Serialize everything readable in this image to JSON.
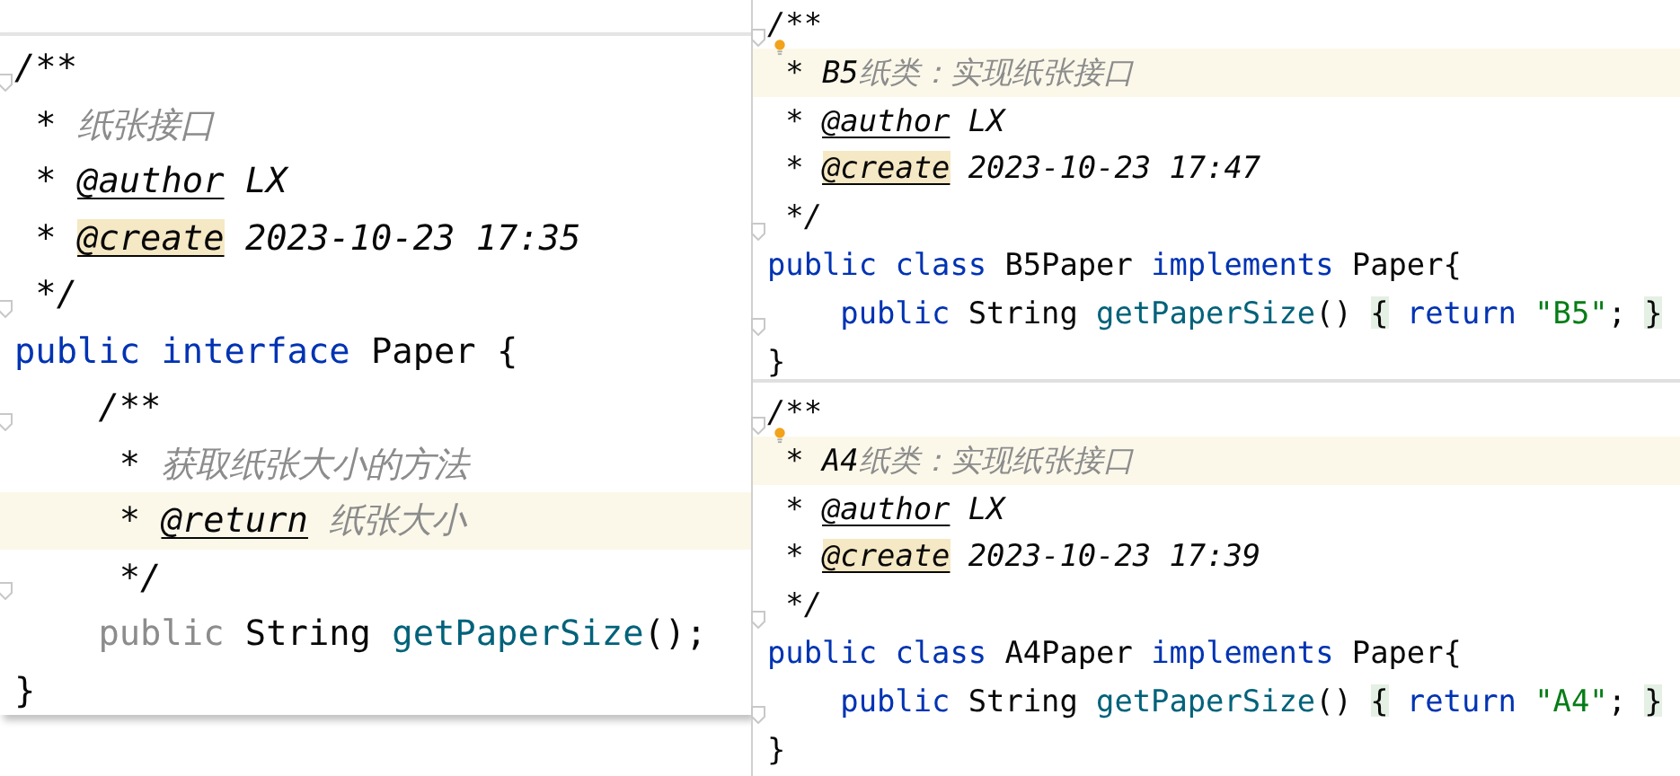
{
  "editors": [
    {
      "lines": [
        {
          "fold": true,
          "highlighted": false,
          "tokens": [
            {
              "text": "/**",
              "kind": "punct"
            }
          ]
        },
        {
          "fold": false,
          "highlighted": false,
          "tokens": [
            {
              "text": " * ",
              "kind": "punct"
            },
            {
              "text": "纸张接口",
              "kind": "doc"
            }
          ]
        },
        {
          "fold": false,
          "highlighted": false,
          "tokens": [
            {
              "text": " * ",
              "kind": "punct"
            },
            {
              "text": "@author",
              "kind": "tag"
            },
            {
              "text": " LX",
              "kind": "value"
            }
          ]
        },
        {
          "fold": false,
          "highlighted": false,
          "tokens": [
            {
              "text": " * ",
              "kind": "punct"
            },
            {
              "text": "@create",
              "kind": "tag-marked"
            },
            {
              "text": " 2023-10-23 17:35",
              "kind": "value"
            }
          ]
        },
        {
          "fold": true,
          "highlighted": false,
          "tokens": [
            {
              "text": " */",
              "kind": "punct"
            }
          ]
        },
        {
          "fold": false,
          "highlighted": false,
          "tokens": [
            {
              "text": "public ",
              "kind": "keyword"
            },
            {
              "text": "interface ",
              "kind": "keyword"
            },
            {
              "text": "Paper {",
              "kind": "plain"
            }
          ]
        },
        {
          "fold": true,
          "highlighted": false,
          "tokens": [
            {
              "text": "    /**",
              "kind": "punct"
            }
          ]
        },
        {
          "fold": false,
          "highlighted": false,
          "tokens": [
            {
              "text": "     * ",
              "kind": "punct"
            },
            {
              "text": "获取纸张大小的方法",
              "kind": "doc"
            }
          ]
        },
        {
          "fold": false,
          "highlighted": true,
          "tokens": [
            {
              "text": "     * ",
              "kind": "punct"
            },
            {
              "text": "@return",
              "kind": "tag"
            },
            {
              "text": " 纸张大小",
              "kind": "doc"
            }
          ]
        },
        {
          "fold": true,
          "highlighted": false,
          "tokens": [
            {
              "text": "     */",
              "kind": "punct"
            }
          ]
        },
        {
          "fold": false,
          "highlighted": false,
          "tokens": [
            {
              "text": "    public ",
              "kind": "dim"
            },
            {
              "text": "String ",
              "kind": "plain"
            },
            {
              "text": "getPaperSize",
              "kind": "method"
            },
            {
              "text": "();",
              "kind": "plain"
            }
          ]
        },
        {
          "fold": false,
          "highlighted": false,
          "tokens": [
            {
              "text": "}",
              "kind": "plain"
            }
          ]
        }
      ]
    },
    {
      "lines": [
        {
          "fold": true,
          "bulb": true,
          "highlighted": false,
          "tokens": [
            {
              "text": "/**",
              "kind": "punct"
            }
          ]
        },
        {
          "fold": false,
          "highlighted": true,
          "tokens": [
            {
              "text": " * ",
              "kind": "punct"
            },
            {
              "text": "B5",
              "kind": "value"
            },
            {
              "text": "纸类：实现纸张接口",
              "kind": "doc"
            }
          ]
        },
        {
          "fold": false,
          "highlighted": false,
          "tokens": [
            {
              "text": " * ",
              "kind": "punct"
            },
            {
              "text": "@author",
              "kind": "tag"
            },
            {
              "text": " LX",
              "kind": "value"
            }
          ]
        },
        {
          "fold": false,
          "highlighted": false,
          "tokens": [
            {
              "text": " * ",
              "kind": "punct"
            },
            {
              "text": "@create",
              "kind": "tag-marked"
            },
            {
              "text": " 2023-10-23 17:47",
              "kind": "value"
            }
          ]
        },
        {
          "fold": true,
          "highlighted": false,
          "tokens": [
            {
              "text": " */",
              "kind": "punct"
            }
          ]
        },
        {
          "fold": false,
          "highlighted": false,
          "tokens": [
            {
              "text": "public ",
              "kind": "keyword"
            },
            {
              "text": "class ",
              "kind": "keyword"
            },
            {
              "text": "B5Paper ",
              "kind": "plain"
            },
            {
              "text": "implements ",
              "kind": "keyword"
            },
            {
              "text": "Paper{",
              "kind": "plain"
            }
          ]
        },
        {
          "fold": true,
          "highlighted": false,
          "tokens": [
            {
              "text": "    public ",
              "kind": "keyword"
            },
            {
              "text": "String ",
              "kind": "plain"
            },
            {
              "text": "getPaperSize",
              "kind": "method"
            },
            {
              "text": "() ",
              "kind": "plain"
            },
            {
              "text": "{",
              "kind": "brace"
            },
            {
              "text": " return ",
              "kind": "keyword"
            },
            {
              "text": "\"B5\"",
              "kind": "string"
            },
            {
              "text": "; ",
              "kind": "plain"
            },
            {
              "text": "}",
              "kind": "brace"
            }
          ]
        },
        {
          "fold": false,
          "highlighted": false,
          "tokens": [
            {
              "text": "}",
              "kind": "plain"
            }
          ]
        }
      ]
    },
    {
      "lines": [
        {
          "fold": true,
          "bulb": true,
          "highlighted": false,
          "tokens": [
            {
              "text": "/**",
              "kind": "punct"
            }
          ]
        },
        {
          "fold": false,
          "highlighted": true,
          "tokens": [
            {
              "text": " * ",
              "kind": "punct"
            },
            {
              "text": "A4",
              "kind": "value"
            },
            {
              "text": "纸类：实现纸张接口",
              "kind": "doc"
            }
          ]
        },
        {
          "fold": false,
          "highlighted": false,
          "tokens": [
            {
              "text": " * ",
              "kind": "punct"
            },
            {
              "text": "@author",
              "kind": "tag"
            },
            {
              "text": " LX",
              "kind": "value"
            }
          ]
        },
        {
          "fold": false,
          "highlighted": false,
          "tokens": [
            {
              "text": " * ",
              "kind": "punct"
            },
            {
              "text": "@create",
              "kind": "tag-marked"
            },
            {
              "text": " 2023-10-23 17:39",
              "kind": "value"
            }
          ]
        },
        {
          "fold": true,
          "highlighted": false,
          "tokens": [
            {
              "text": " */",
              "kind": "punct"
            }
          ]
        },
        {
          "fold": false,
          "highlighted": false,
          "tokens": [
            {
              "text": "public ",
              "kind": "keyword"
            },
            {
              "text": "class ",
              "kind": "keyword"
            },
            {
              "text": "A4Paper ",
              "kind": "plain"
            },
            {
              "text": "implements ",
              "kind": "keyword"
            },
            {
              "text": "Paper{",
              "kind": "plain"
            }
          ]
        },
        {
          "fold": true,
          "highlighted": false,
          "tokens": [
            {
              "text": "    public ",
              "kind": "keyword"
            },
            {
              "text": "String ",
              "kind": "plain"
            },
            {
              "text": "getPaperSize",
              "kind": "method"
            },
            {
              "text": "() ",
              "kind": "plain"
            },
            {
              "text": "{",
              "kind": "brace"
            },
            {
              "text": " return ",
              "kind": "keyword"
            },
            {
              "text": "\"A4\"",
              "kind": "string"
            },
            {
              "text": "; ",
              "kind": "plain"
            },
            {
              "text": "}",
              "kind": "brace"
            }
          ]
        },
        {
          "fold": false,
          "highlighted": false,
          "tokens": [
            {
              "text": "}",
              "kind": "plain"
            }
          ]
        }
      ]
    }
  ]
}
